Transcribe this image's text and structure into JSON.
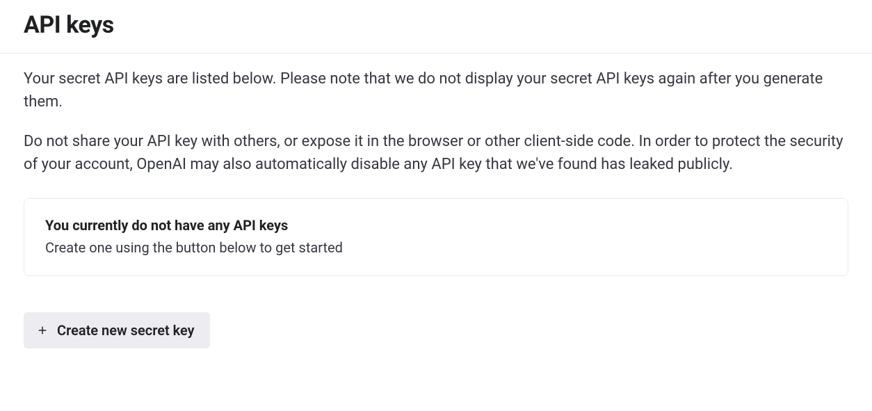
{
  "header": {
    "title": "API keys"
  },
  "content": {
    "description1": "Your secret API keys are listed below. Please note that we do not display your secret API keys again after you generate them.",
    "description2": "Do not share your API key with others, or expose it in the browser or other client-side code. In order to protect the security of your account, OpenAI may also automatically disable any API key that we've found has leaked publicly.",
    "empty_state": {
      "title": "You currently do not have any API keys",
      "subtitle": "Create one using the button below to get started"
    },
    "create_button_label": "Create new secret key"
  }
}
